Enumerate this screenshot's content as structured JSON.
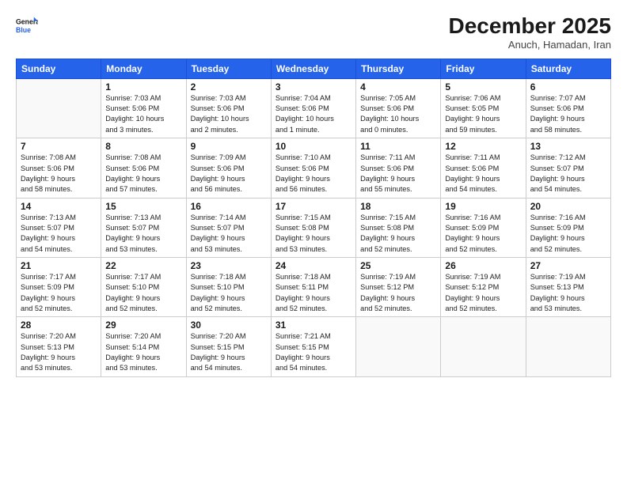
{
  "logo": {
    "line1": "General",
    "line2": "Blue"
  },
  "title": "December 2025",
  "subtitle": "Anuch, Hamadan, Iran",
  "header_days": [
    "Sunday",
    "Monday",
    "Tuesday",
    "Wednesday",
    "Thursday",
    "Friday",
    "Saturday"
  ],
  "weeks": [
    [
      {
        "day": "",
        "info": ""
      },
      {
        "day": "1",
        "info": "Sunrise: 7:03 AM\nSunset: 5:06 PM\nDaylight: 10 hours\nand 3 minutes."
      },
      {
        "day": "2",
        "info": "Sunrise: 7:03 AM\nSunset: 5:06 PM\nDaylight: 10 hours\nand 2 minutes."
      },
      {
        "day": "3",
        "info": "Sunrise: 7:04 AM\nSunset: 5:06 PM\nDaylight: 10 hours\nand 1 minute."
      },
      {
        "day": "4",
        "info": "Sunrise: 7:05 AM\nSunset: 5:06 PM\nDaylight: 10 hours\nand 0 minutes."
      },
      {
        "day": "5",
        "info": "Sunrise: 7:06 AM\nSunset: 5:05 PM\nDaylight: 9 hours\nand 59 minutes."
      },
      {
        "day": "6",
        "info": "Sunrise: 7:07 AM\nSunset: 5:06 PM\nDaylight: 9 hours\nand 58 minutes."
      }
    ],
    [
      {
        "day": "7",
        "info": "Sunrise: 7:08 AM\nSunset: 5:06 PM\nDaylight: 9 hours\nand 58 minutes."
      },
      {
        "day": "8",
        "info": "Sunrise: 7:08 AM\nSunset: 5:06 PM\nDaylight: 9 hours\nand 57 minutes."
      },
      {
        "day": "9",
        "info": "Sunrise: 7:09 AM\nSunset: 5:06 PM\nDaylight: 9 hours\nand 56 minutes."
      },
      {
        "day": "10",
        "info": "Sunrise: 7:10 AM\nSunset: 5:06 PM\nDaylight: 9 hours\nand 56 minutes."
      },
      {
        "day": "11",
        "info": "Sunrise: 7:11 AM\nSunset: 5:06 PM\nDaylight: 9 hours\nand 55 minutes."
      },
      {
        "day": "12",
        "info": "Sunrise: 7:11 AM\nSunset: 5:06 PM\nDaylight: 9 hours\nand 54 minutes."
      },
      {
        "day": "13",
        "info": "Sunrise: 7:12 AM\nSunset: 5:07 PM\nDaylight: 9 hours\nand 54 minutes."
      }
    ],
    [
      {
        "day": "14",
        "info": "Sunrise: 7:13 AM\nSunset: 5:07 PM\nDaylight: 9 hours\nand 54 minutes."
      },
      {
        "day": "15",
        "info": "Sunrise: 7:13 AM\nSunset: 5:07 PM\nDaylight: 9 hours\nand 53 minutes."
      },
      {
        "day": "16",
        "info": "Sunrise: 7:14 AM\nSunset: 5:07 PM\nDaylight: 9 hours\nand 53 minutes."
      },
      {
        "day": "17",
        "info": "Sunrise: 7:15 AM\nSunset: 5:08 PM\nDaylight: 9 hours\nand 53 minutes."
      },
      {
        "day": "18",
        "info": "Sunrise: 7:15 AM\nSunset: 5:08 PM\nDaylight: 9 hours\nand 52 minutes."
      },
      {
        "day": "19",
        "info": "Sunrise: 7:16 AM\nSunset: 5:09 PM\nDaylight: 9 hours\nand 52 minutes."
      },
      {
        "day": "20",
        "info": "Sunrise: 7:16 AM\nSunset: 5:09 PM\nDaylight: 9 hours\nand 52 minutes."
      }
    ],
    [
      {
        "day": "21",
        "info": "Sunrise: 7:17 AM\nSunset: 5:09 PM\nDaylight: 9 hours\nand 52 minutes."
      },
      {
        "day": "22",
        "info": "Sunrise: 7:17 AM\nSunset: 5:10 PM\nDaylight: 9 hours\nand 52 minutes."
      },
      {
        "day": "23",
        "info": "Sunrise: 7:18 AM\nSunset: 5:10 PM\nDaylight: 9 hours\nand 52 minutes."
      },
      {
        "day": "24",
        "info": "Sunrise: 7:18 AM\nSunset: 5:11 PM\nDaylight: 9 hours\nand 52 minutes."
      },
      {
        "day": "25",
        "info": "Sunrise: 7:19 AM\nSunset: 5:12 PM\nDaylight: 9 hours\nand 52 minutes."
      },
      {
        "day": "26",
        "info": "Sunrise: 7:19 AM\nSunset: 5:12 PM\nDaylight: 9 hours\nand 52 minutes."
      },
      {
        "day": "27",
        "info": "Sunrise: 7:19 AM\nSunset: 5:13 PM\nDaylight: 9 hours\nand 53 minutes."
      }
    ],
    [
      {
        "day": "28",
        "info": "Sunrise: 7:20 AM\nSunset: 5:13 PM\nDaylight: 9 hours\nand 53 minutes."
      },
      {
        "day": "29",
        "info": "Sunrise: 7:20 AM\nSunset: 5:14 PM\nDaylight: 9 hours\nand 53 minutes."
      },
      {
        "day": "30",
        "info": "Sunrise: 7:20 AM\nSunset: 5:15 PM\nDaylight: 9 hours\nand 54 minutes."
      },
      {
        "day": "31",
        "info": "Sunrise: 7:21 AM\nSunset: 5:15 PM\nDaylight: 9 hours\nand 54 minutes."
      },
      {
        "day": "",
        "info": ""
      },
      {
        "day": "",
        "info": ""
      },
      {
        "day": "",
        "info": ""
      }
    ]
  ]
}
